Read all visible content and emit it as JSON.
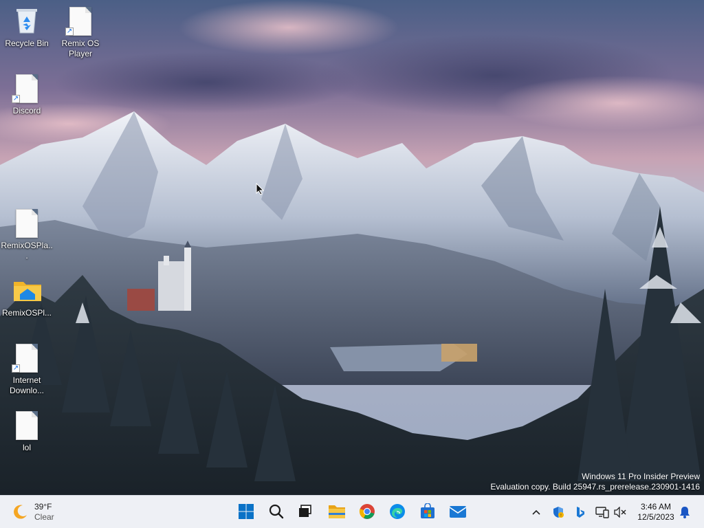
{
  "desktop": {
    "icons": [
      {
        "label": "Recycle Bin"
      },
      {
        "label": "Remix OS Player"
      },
      {
        "label": "Discord"
      },
      {
        "label": "RemixOSPla..."
      },
      {
        "label": "RemixOSPl..."
      },
      {
        "label": "Internet Downlo..."
      },
      {
        "label": "lol"
      }
    ]
  },
  "watermark": {
    "line1": "Windows 11 Pro Insider Preview",
    "line2": "Evaluation copy. Build 25947.rs_prerelease.230901-1416"
  },
  "taskbar": {
    "weather": {
      "temperature": "39°F",
      "condition": "Clear",
      "icon": "moon-weather-icon"
    },
    "apps": [
      {
        "name": "start",
        "icon": "windows-logo-icon",
        "color": "#0a72c7"
      },
      {
        "name": "search",
        "icon": "search-icon",
        "color": "#1a1a1a"
      },
      {
        "name": "task-view",
        "icon": "task-view-icon",
        "color": "#1a1a1a"
      },
      {
        "name": "file-explorer",
        "icon": "folder-icon",
        "color": "#f4c542"
      },
      {
        "name": "chrome",
        "icon": "chrome-icon",
        "color": "#db4437"
      },
      {
        "name": "edge",
        "icon": "edge-icon",
        "color": "#0c8ce9"
      },
      {
        "name": "store",
        "icon": "store-icon",
        "color": "#1e6fd0"
      },
      {
        "name": "mail",
        "icon": "mail-icon",
        "color": "#1a78d4"
      }
    ],
    "tray": {
      "time": "3:46 AM",
      "date": "12/5/2023"
    }
  }
}
